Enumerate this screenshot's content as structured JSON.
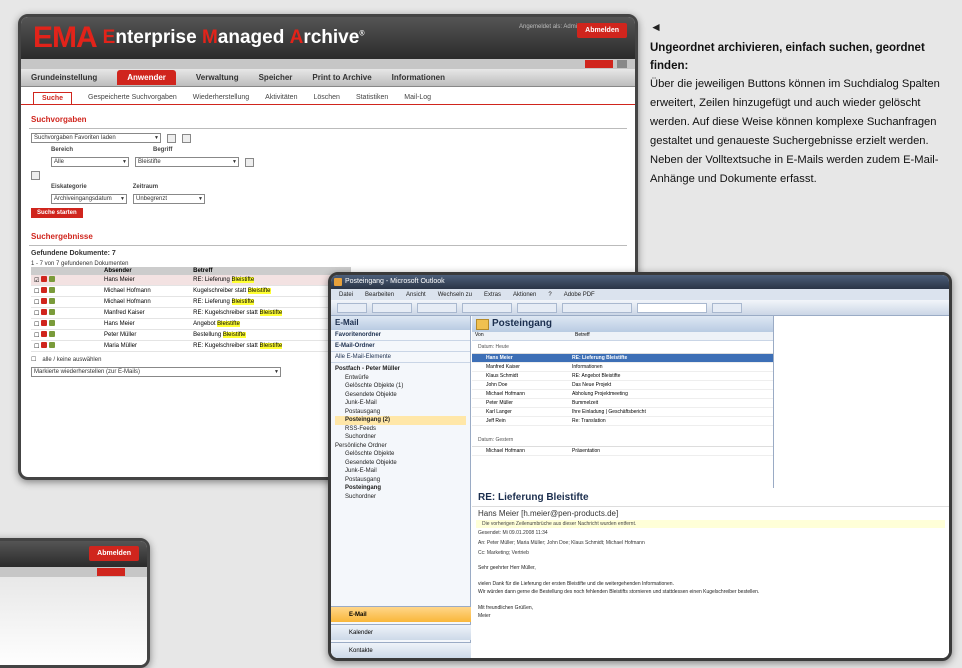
{
  "ema": {
    "logo": "EMA",
    "brand_e": "E",
    "brand_rest1": "nterprise ",
    "brand_m": "M",
    "brand_rest2": "anaged ",
    "brand_a": "A",
    "brand_rest3": "rchive",
    "tm": "®",
    "user": "Angemeldet als: Administrator",
    "logout": "Abmelden",
    "nav": [
      "Grundeinstellung",
      "Anwender",
      "Verwaltung",
      "Speicher",
      "Print to Archive",
      "Informationen"
    ],
    "subnav": [
      "Suche",
      "Gespeicherte Suchvorgaben",
      "Wiederherstellung",
      "Aktivitäten",
      "Löschen",
      "Statistiken",
      "Mail-Log"
    ],
    "suchvorgaben_title": "Suchvorgaben",
    "suchvorgaben_select": "Suchvorgaben Favoriten laden",
    "bereich_label": "Bereich",
    "begriff_label": "Begriff",
    "bereich_value": "Alle",
    "begriff_value": "Bleistifte",
    "eingang_label": "Eiskategorie",
    "zeitraum_label": "Zeitraum",
    "eingang_value": "Archiveingangsdatum",
    "zeitraum_value": "Unbegrenzt",
    "search_btn": "Suche starten",
    "results_title": "Suchergebnisse",
    "results_sub": "Gefundene Dokumente: 7",
    "results_count": "1 - 7 von 7 gefundenen Dokumenten",
    "col_absender": "Absender",
    "col_betreff": "Betreff",
    "rows": [
      {
        "from": "Hans Meier",
        "subj": "RE: Lieferung ",
        "mark": "Bleistifte"
      },
      {
        "from": "Michael Hofmann",
        "subj": "Kugelschreiber statt ",
        "mark": "Bleistifte"
      },
      {
        "from": "Michael Hofmann",
        "subj": "RE: Lieferung ",
        "mark": "Bleistifte"
      },
      {
        "from": "Manfred Kaiser",
        "subj": "RE: Kugelschreiber statt ",
        "mark": "Bleistifte"
      },
      {
        "from": "Hans Meier",
        "subj": "Angebot ",
        "mark": "Bleistifte"
      },
      {
        "from": "Peter Müller",
        "subj": "Bestellung ",
        "mark": "Bleistifte"
      },
      {
        "from": "Maria Müller",
        "subj": "RE: Kugelschreiber statt ",
        "mark": "Bleistifte"
      }
    ],
    "select_all": "alle / keine auswählen",
    "action_select": "Markierte wiederherstellen (zur E-Mails)"
  },
  "outlook": {
    "title": "Posteingang - Microsoft Outlook",
    "menu": [
      "Datei",
      "Bearbeiten",
      "Ansicht",
      "Wechseln zu",
      "Extras",
      "Aktionen",
      "?",
      "Adobe PDF"
    ],
    "pane_title": "E-Mail",
    "favoriten": "Favoritenordner",
    "email_ordner": "E-Mail-Ordner",
    "alle": "Alle E-Mail-Elemente",
    "tree": [
      "Postfach - Peter Müller",
      "Entwürfe",
      "Gelöschte Objekte (1)",
      "Gesendete Objekte",
      "Junk-E-Mail",
      "Postausgang",
      "Posteingang (2)",
      "RSS-Feeds",
      "Suchordner",
      "Persönliche Ordner",
      "Gelöschte Objekte",
      "Gesendete Objekte",
      "Junk-E-Mail",
      "Postausgang",
      "Posteingang",
      "Suchordner"
    ],
    "nav_mail": "E-Mail",
    "nav_cal": "Kalender",
    "nav_kontakte": "Kontakte",
    "inbox": "Posteingang",
    "col_from": "Von",
    "col_subj": "Betreff",
    "grp_today": "Datum: Heute",
    "mails": [
      {
        "from": "Hans Meier",
        "subj": "RE: Lieferung Bleistifte"
      },
      {
        "from": "Manfred Kaiser",
        "subj": "Informationen"
      },
      {
        "from": "Klaus Schmidt",
        "subj": "RE: Angebot Bleistifte"
      },
      {
        "from": "John Doe",
        "subj": "Das Neue Projekt"
      },
      {
        "from": "Michael Hofmann",
        "subj": "Abholung Projektmeeting"
      },
      {
        "from": "Peter Müller",
        "subj": "Bummelzeit"
      },
      {
        "from": "Karl Langer",
        "subj": "Ihre Einladung | Geschäftsbericht"
      },
      {
        "from": "Jeff Rein",
        "subj": "Re: Translation"
      }
    ],
    "grp_older": "Datum: Gestern",
    "older": {
      "from": "Michael Hofmann",
      "subj": "Präsentation"
    },
    "read_subj": "RE: Lieferung Bleistifte",
    "read_from": "Hans Meier [h.meier@pen-products.de]",
    "read_info": "Die vorherigen Zeilenumbrüche aus dieser Nachricht wurden entfernt.",
    "meta_gesendet": "Gesendet: Mi 09.01.2008 11:34",
    "meta_an": "An: Peter Müller; Maria Müller; John Doe; Klaus Schmidt; Michael Hofmann",
    "meta_cc": "Cc: Marketing; Vertrieb",
    "body1": "Sehr geehrter Herr Müller,",
    "body2": "vielen Dank für die Lieferung der ersten Bleistifte und die weitergehenden Informationen.",
    "body3": "Wir würden dann gerne die Bestellung des noch fehlenden Bleistifts stornieren und stattdessen einen Kugelschreiber bestellen.",
    "body4": "Mit freundlichen Grüßen,",
    "body5": "Meier"
  },
  "text": {
    "arrow": "◄",
    "heading": "Ungeordnet archivieren, einfach suchen, geordnet finden:",
    "body": "Über die jeweiligen Buttons können im Suchdialog Spalten erweitert, Zeilen hinzugefügt und auch wieder gelöscht werden. Auf diese Weise können komplexe Suchanfragen gestaltet und genaueste Suchergebnisse erzielt werden. Neben der Volltextsuche in E-Mails werden zudem E-Mail-Anhänge und Dokumente erfasst."
  }
}
